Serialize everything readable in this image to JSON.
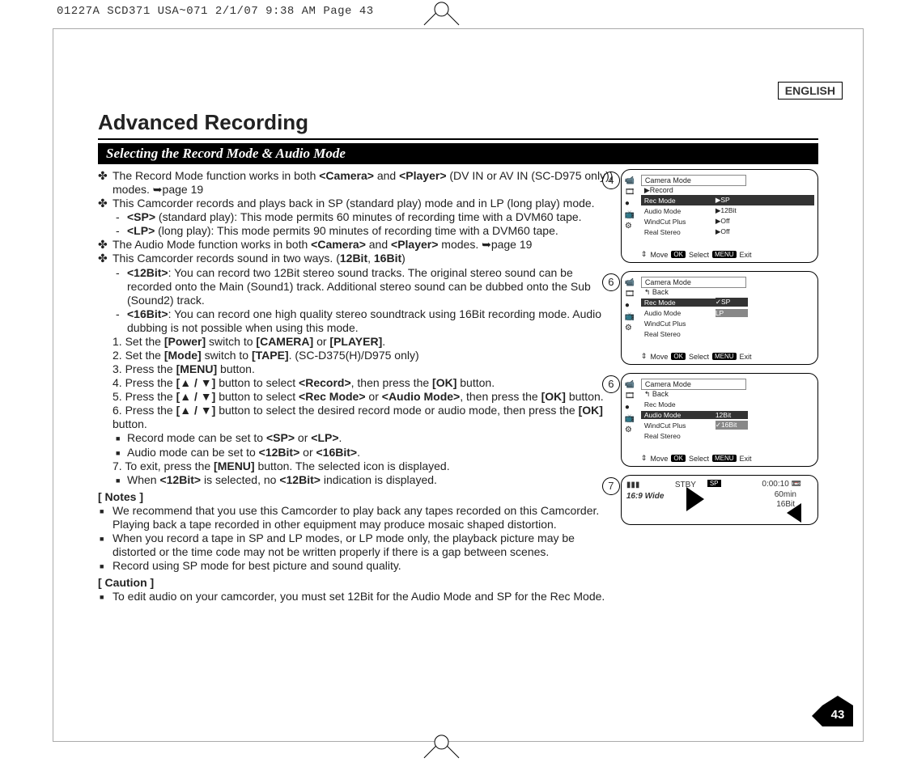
{
  "header_line": "01227A SCD371 USA~071  2/1/07 9:38 AM  Page 43",
  "language": "ENGLISH",
  "title": "Advanced Recording",
  "section_bar": "Selecting the Record Mode & Audio Mode",
  "page_number": "43",
  "body": {
    "b1": "The Record Mode function works in both ",
    "b1b1": "<Camera>",
    "b1m": " and ",
    "b1b2": "<Player>",
    "b1t": " (DV IN or AV IN (SC-D975 only)) modes. ➥page 19",
    "b2": "This Camcorder records and plays back in SP (standard play) mode and in LP (long play) mode.",
    "b2d1b": "<SP>",
    "b2d1": " (standard play): This mode permits 60 minutes of recording time with a DVM60 tape.",
    "b2d2b": "<LP>",
    "b2d2": " (long play): This mode permits 90 minutes of recording time with a DVM60 tape.",
    "b3a": "The Audio Mode function works in both ",
    "b3b1": "<Camera>",
    "b3m": " and ",
    "b3b2": "<Player>",
    "b3t": " modes. ➥page 19",
    "b4a": "This Camcorder records sound in two ways. (",
    "b4b1": "12Bit",
    "b4m": ", ",
    "b4b2": "16Bit",
    "b4t": ")",
    "b4d1b": "<12Bit>",
    "b4d1": ": You can record two 12Bit stereo sound tracks. The original stereo sound can be recorded onto the Main (Sound1) track. Additional stereo sound can be dubbed onto the Sub (Sound2) track.",
    "b4d2b": "<16Bit>",
    "b4d2": ": You can record one high quality stereo soundtrack using 16Bit recording mode. Audio dubbing is not possible when using this mode.",
    "s1a": "1. Set the ",
    "s1b1": "[Power]",
    "s1m": " switch to ",
    "s1b2": "[CAMERA]",
    "s1m2": " or ",
    "s1b3": "[PLAYER]",
    "s1t": ".",
    "s2a": "2. Set the ",
    "s2b1": "[Mode]",
    "s2m": " switch to ",
    "s2b2": "[TAPE]",
    "s2t": ". (SC-D375(H)/D975 only)",
    "s3a": "3. Press the ",
    "s3b1": "[MENU]",
    "s3t": " button.",
    "s4a": "4. Press the ",
    "s4b1": "[▲ / ▼]",
    "s4m": " button to select ",
    "s4b2": "<Record>",
    "s4m2": ", then press the ",
    "s4b3": "[OK]",
    "s4t": " button.",
    "s5a": "5. Press the ",
    "s5b1": "[▲ / ▼]",
    "s5m": " button to select ",
    "s5b2": "<Rec Mode>",
    "s5m2": " or ",
    "s5b3": "<Audio Mode>",
    "s5m3": ", then press the ",
    "s5b4": "[OK]",
    "s5t": " button.",
    "s6a": "6. Press the ",
    "s6b1": "[▲ / ▼]",
    "s6m": " button to select the desired record mode or audio mode, then press the ",
    "s6b2": "[OK]",
    "s6t": " button.",
    "s6sq1a": "Record mode can be set to ",
    "s6sq1b1": "<SP>",
    "s6sq1m": " or ",
    "s6sq1b2": "<LP>",
    "s6sq1t": ".",
    "s6sq2a": "Audio mode can be set to ",
    "s6sq2b1": "<12Bit>",
    "s6sq2m": " or ",
    "s6sq2b2": "<16Bit>",
    "s6sq2t": ".",
    "s7a": "7. To exit, press the ",
    "s7b1": "[MENU]",
    "s7t": " button. The selected icon is displayed.",
    "s7sq1a": "When ",
    "s7sq1b1": "<12Bit>",
    "s7sq1m": " is selected, no ",
    "s7sq1b2": "<12Bit>",
    "s7sq1t": " indication is displayed.",
    "notes_hd": "[ Notes ]",
    "n1": "We recommend that you use this Camcorder to play back any tapes recorded on this Camcorder.",
    "n1b": "Playing back a tape recorded in other equipment may produce mosaic shaped distortion.",
    "n2": "When you record a tape in SP and LP modes, or LP mode only, the playback picture may be distorted or the time code may not be written properly if there is a gap between scenes.",
    "n3": "Record using SP mode for best picture and sound quality.",
    "caution_hd": "[ Caution ]",
    "c1": "To edit audio on your camcorder, you must set 12Bit for the Audio Mode and SP for the Rec Mode."
  },
  "panels": {
    "p4": {
      "step": "4",
      "title": "Camera Mode",
      "sub": "▶Record",
      "rows": [
        {
          "label": "Rec Mode",
          "val": "▶SP"
        },
        {
          "label": "Audio Mode",
          "val": "▶12Bit"
        },
        {
          "label": "WindCut Plus",
          "val": "▶Off"
        },
        {
          "label": "Real Stereo",
          "val": "▶Off"
        }
      ],
      "footer": {
        "move": "Move",
        "ok": "OK",
        "select": "Select",
        "menu": "MENU",
        "exit": "Exit"
      }
    },
    "p6a": {
      "step": "6",
      "title": "Camera Mode",
      "sub": "Back",
      "rows": [
        {
          "label": "Rec Mode",
          "val": "✓SP",
          "hl": true
        },
        {
          "label": "Audio Mode",
          "val": "LP",
          "sel": true
        },
        {
          "label": "WindCut Plus",
          "val": ""
        },
        {
          "label": "Real Stereo",
          "val": ""
        }
      ],
      "footer": {
        "move": "Move",
        "ok": "OK",
        "select": "Select",
        "menu": "MENU",
        "exit": "Exit"
      }
    },
    "p6b": {
      "step": "6",
      "title": "Camera Mode",
      "sub": "Back",
      "rows": [
        {
          "label": "Rec Mode",
          "val": ""
        },
        {
          "label": "Audio Mode",
          "val": "12Bit",
          "hl": true
        },
        {
          "label": "WindCut Plus",
          "val": "✓16Bit",
          "sel": true
        },
        {
          "label": "Real Stereo",
          "val": ""
        }
      ],
      "footer": {
        "move": "Move",
        "ok": "OK",
        "select": "Select",
        "menu": "MENU",
        "exit": "Exit"
      }
    },
    "p7": {
      "step": "7",
      "wide": "16:9 Wide",
      "stby": "STBY",
      "sp": "SP",
      "time": "0:00:10",
      "rem": "60min",
      "bit": "16Bit"
    }
  }
}
